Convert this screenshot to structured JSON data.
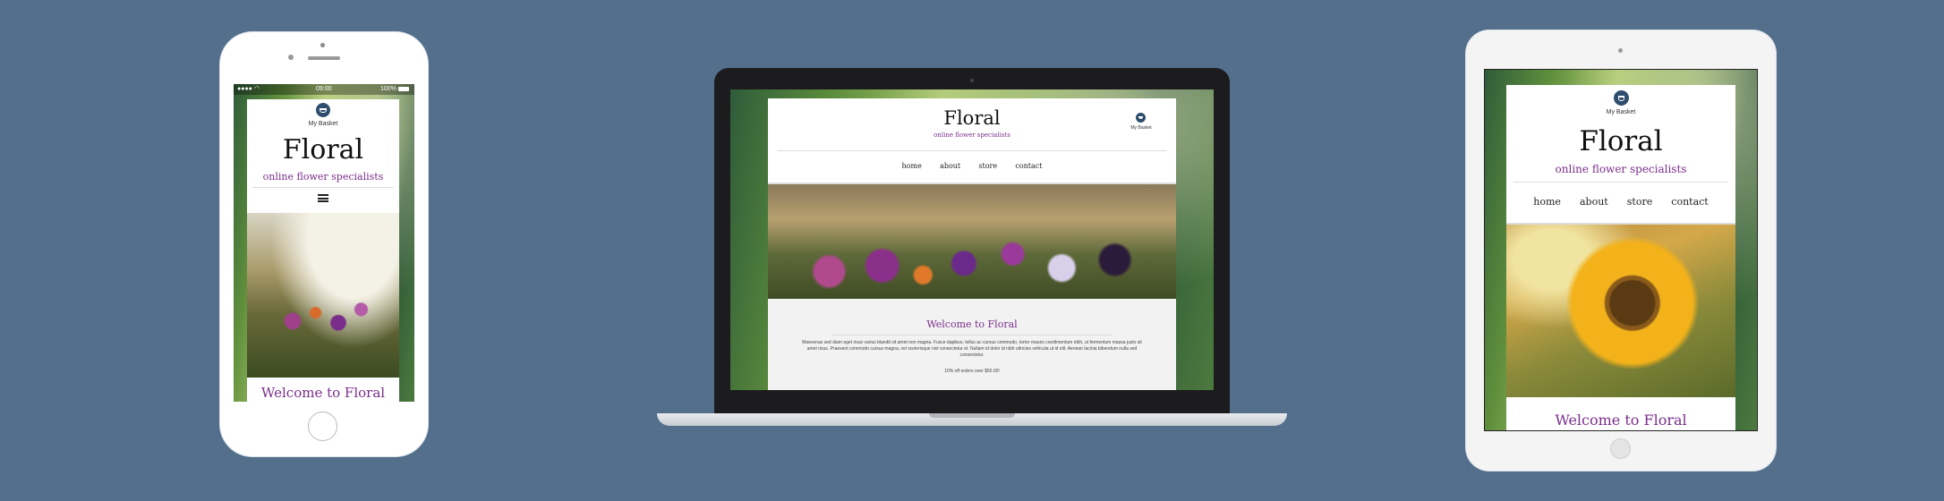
{
  "site": {
    "logo": "Floral",
    "tagline": "online flower specialists",
    "basket_label": "My Basket",
    "nav": [
      "home",
      "about",
      "store",
      "contact"
    ],
    "welcome": "Welcome to Floral",
    "offer": "10% off orders over $50.00!",
    "intro": "Maecenas sed diam eget risus varius blandit sit amet non magna. Fusce dapibus, tellus ac cursus commodo, tortor mauris condimentum nibh, ut fermentum massa justo sit amet risus. Praesent commodo cursus magna, vel scelerisque nisl consectetur et. Nullam id dolor id nibh ultricies vehicula ut id elit. Aenean lacinia bibendum nulla sed consectetur."
  },
  "phone_status": {
    "time": "09:00",
    "battery": "100%"
  },
  "icons": {
    "basket": "basket-icon",
    "menu": "hamburger-menu-icon",
    "home_button": "home-button-icon"
  },
  "colors": {
    "background": "#536f8c",
    "accent": "#7a2e8a"
  }
}
